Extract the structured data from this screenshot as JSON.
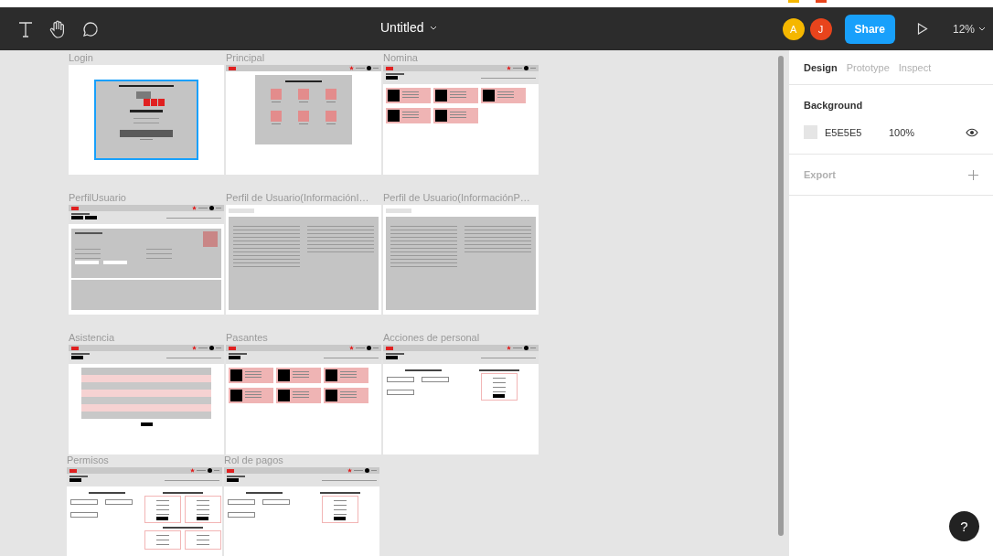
{
  "toolbar": {
    "title": "Untitled",
    "avatars": [
      {
        "initial": "A",
        "color": "#f5b700"
      },
      {
        "initial": "J",
        "color": "#e8441c"
      }
    ],
    "share": "Share",
    "zoom": "12%"
  },
  "canvas": {
    "rows": [
      [
        {
          "title": "Login",
          "kind": "login",
          "selected": true
        },
        {
          "title": "Principal",
          "kind": "menu"
        },
        {
          "title": "Nomina",
          "kind": "cards",
          "cards": [
            {
              "kind": "card"
            },
            {
              "kind": "card"
            },
            {
              "kind": "card"
            },
            {
              "kind": "card"
            },
            {
              "kind": "card"
            }
          ]
        }
      ],
      [
        {
          "title": "PerfilUsuario",
          "kind": "profile"
        },
        {
          "title": "Perfil de Usuario(InformaciónI…",
          "kind": "form"
        },
        {
          "title": "Perfil de Usuario(InformaciónP…",
          "kind": "form"
        }
      ],
      [
        {
          "title": "Asistencia",
          "kind": "table"
        },
        {
          "title": "Pasantes",
          "kind": "cards",
          "cards": [
            {
              "kind": "card"
            },
            {
              "kind": "card"
            },
            {
              "kind": "card"
            },
            {
              "kind": "card"
            },
            {
              "kind": "card"
            },
            {
              "kind": "card"
            }
          ]
        },
        {
          "title": "Acciones de personal",
          "kind": "twocol",
          "box_rows": [
            [
              {
                "kind": "box"
              }
            ]
          ]
        }
      ],
      [
        {
          "title": "Permisos",
          "kind": "twocol",
          "box_rows": [
            [
              {
                "kind": "box"
              },
              {
                "kind": "box"
              }
            ],
            [
              {
                "kind": "box"
              },
              {
                "kind": "box"
              }
            ]
          ]
        },
        {
          "title": "Rol de pagos",
          "kind": "twocol",
          "box_rows": [
            [
              {
                "kind": "box"
              }
            ]
          ]
        }
      ]
    ]
  },
  "panel": {
    "tabs": [
      {
        "label": "Design",
        "selected": true
      },
      {
        "label": "Prototype",
        "selected": false
      },
      {
        "label": "Inspect",
        "selected": false
      }
    ],
    "background": {
      "heading": "Background",
      "hex": "E5E5E5",
      "opacity": "100%",
      "visible": true
    },
    "export": {
      "heading": "Export"
    }
  },
  "help": "?"
}
